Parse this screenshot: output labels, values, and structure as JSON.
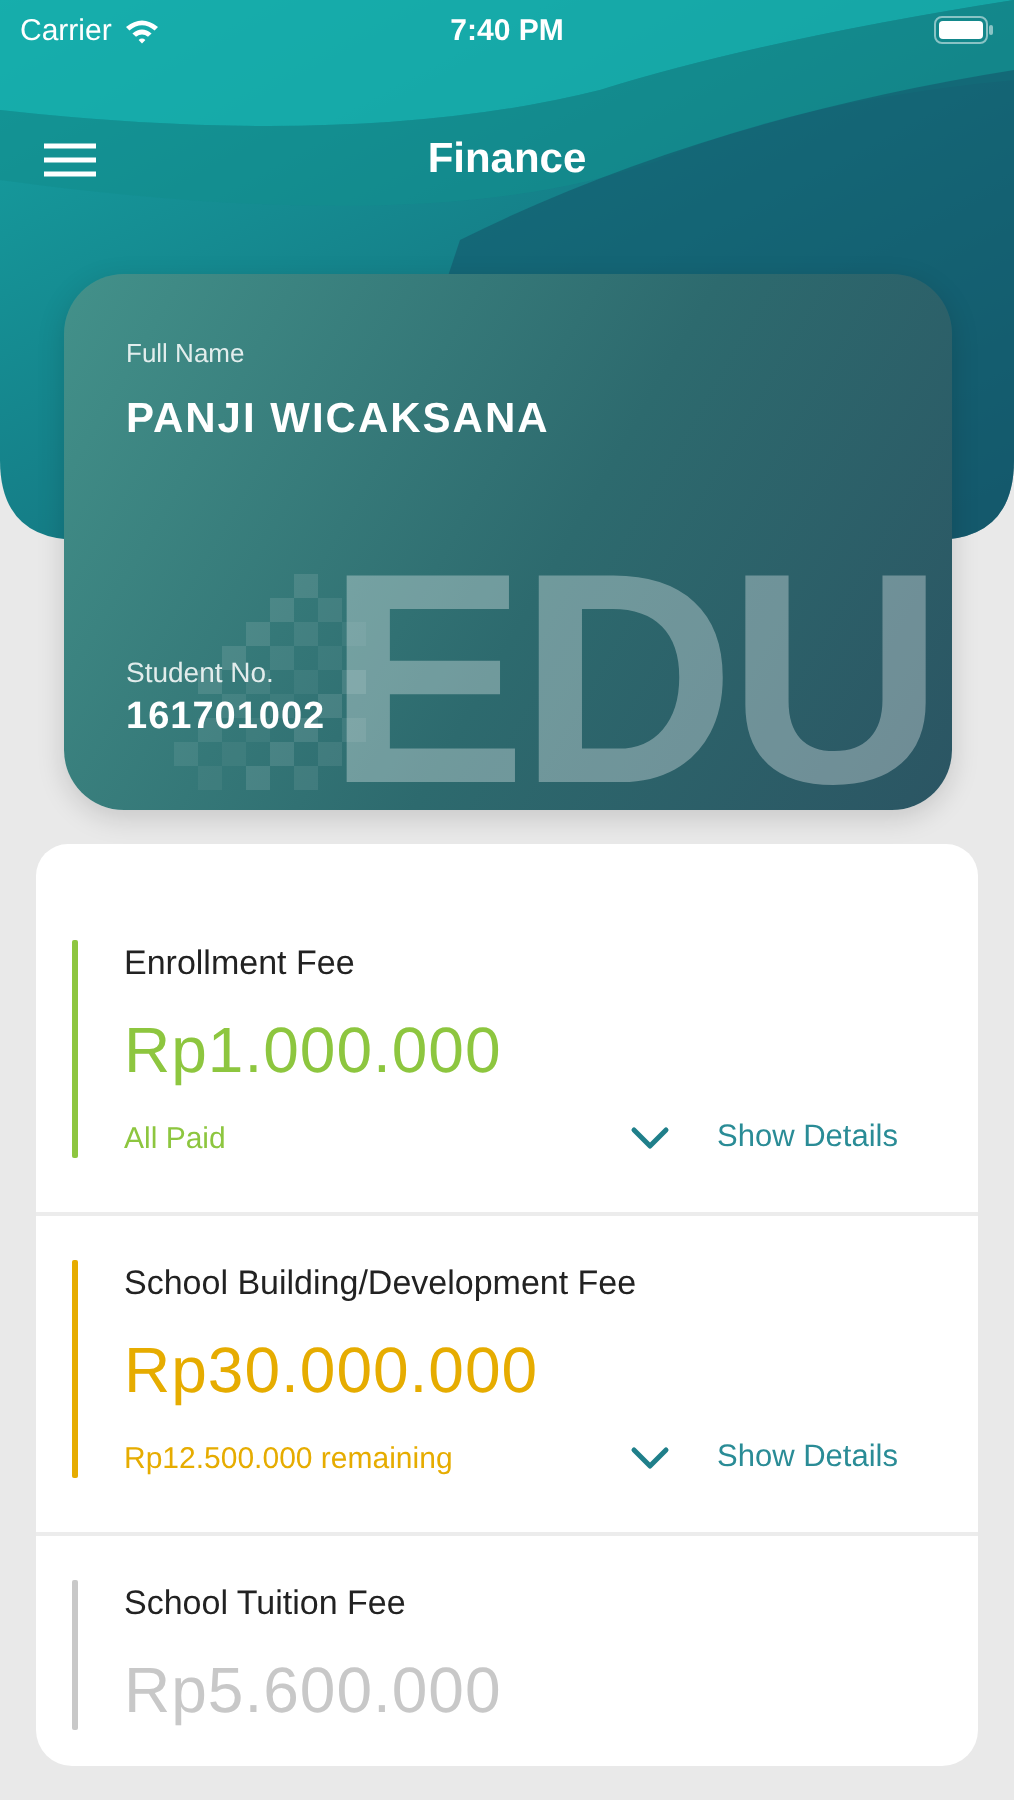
{
  "status_bar": {
    "carrier": "Carrier",
    "time": "7:40 PM"
  },
  "nav": {
    "title": "Finance"
  },
  "student_card": {
    "name_label": "Full Name",
    "name": "PANJI WICAKSANA",
    "number_label": "Student No.",
    "number": "161701002",
    "emblem": "EDU"
  },
  "fees": [
    {
      "title": "Enrollment Fee",
      "amount": "Rp1.000.000",
      "status": "All Paid",
      "action": "Show Details",
      "color": "#8dc63f"
    },
    {
      "title": "School Building/Development Fee",
      "amount": "Rp30.000.000",
      "status": "Rp12.500.000 remaining",
      "action": "Show Details",
      "color": "#e6ac00"
    },
    {
      "title": "School Tuition Fee",
      "amount": "Rp5.600.000",
      "color": "#c8c8c8"
    }
  ]
}
